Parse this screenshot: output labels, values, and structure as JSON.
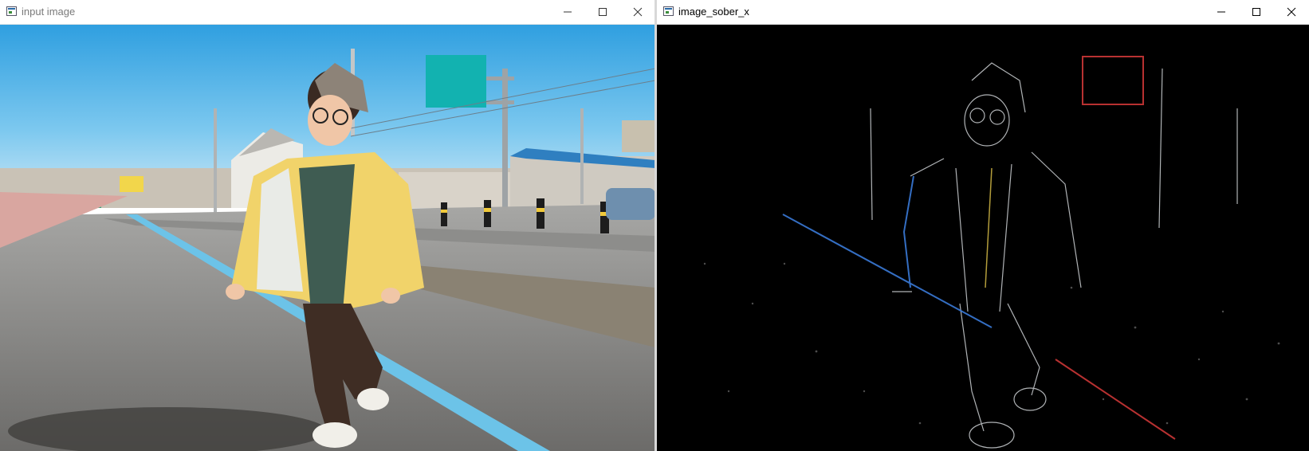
{
  "windows": [
    {
      "title": "input image"
    },
    {
      "title": "image_sober_x"
    }
  ],
  "icons": {
    "app": "opencv-window-icon",
    "minimize": "minimize-icon",
    "maximize": "maximize-icon",
    "close": "close-icon"
  },
  "scene": {
    "description_free": true
  }
}
